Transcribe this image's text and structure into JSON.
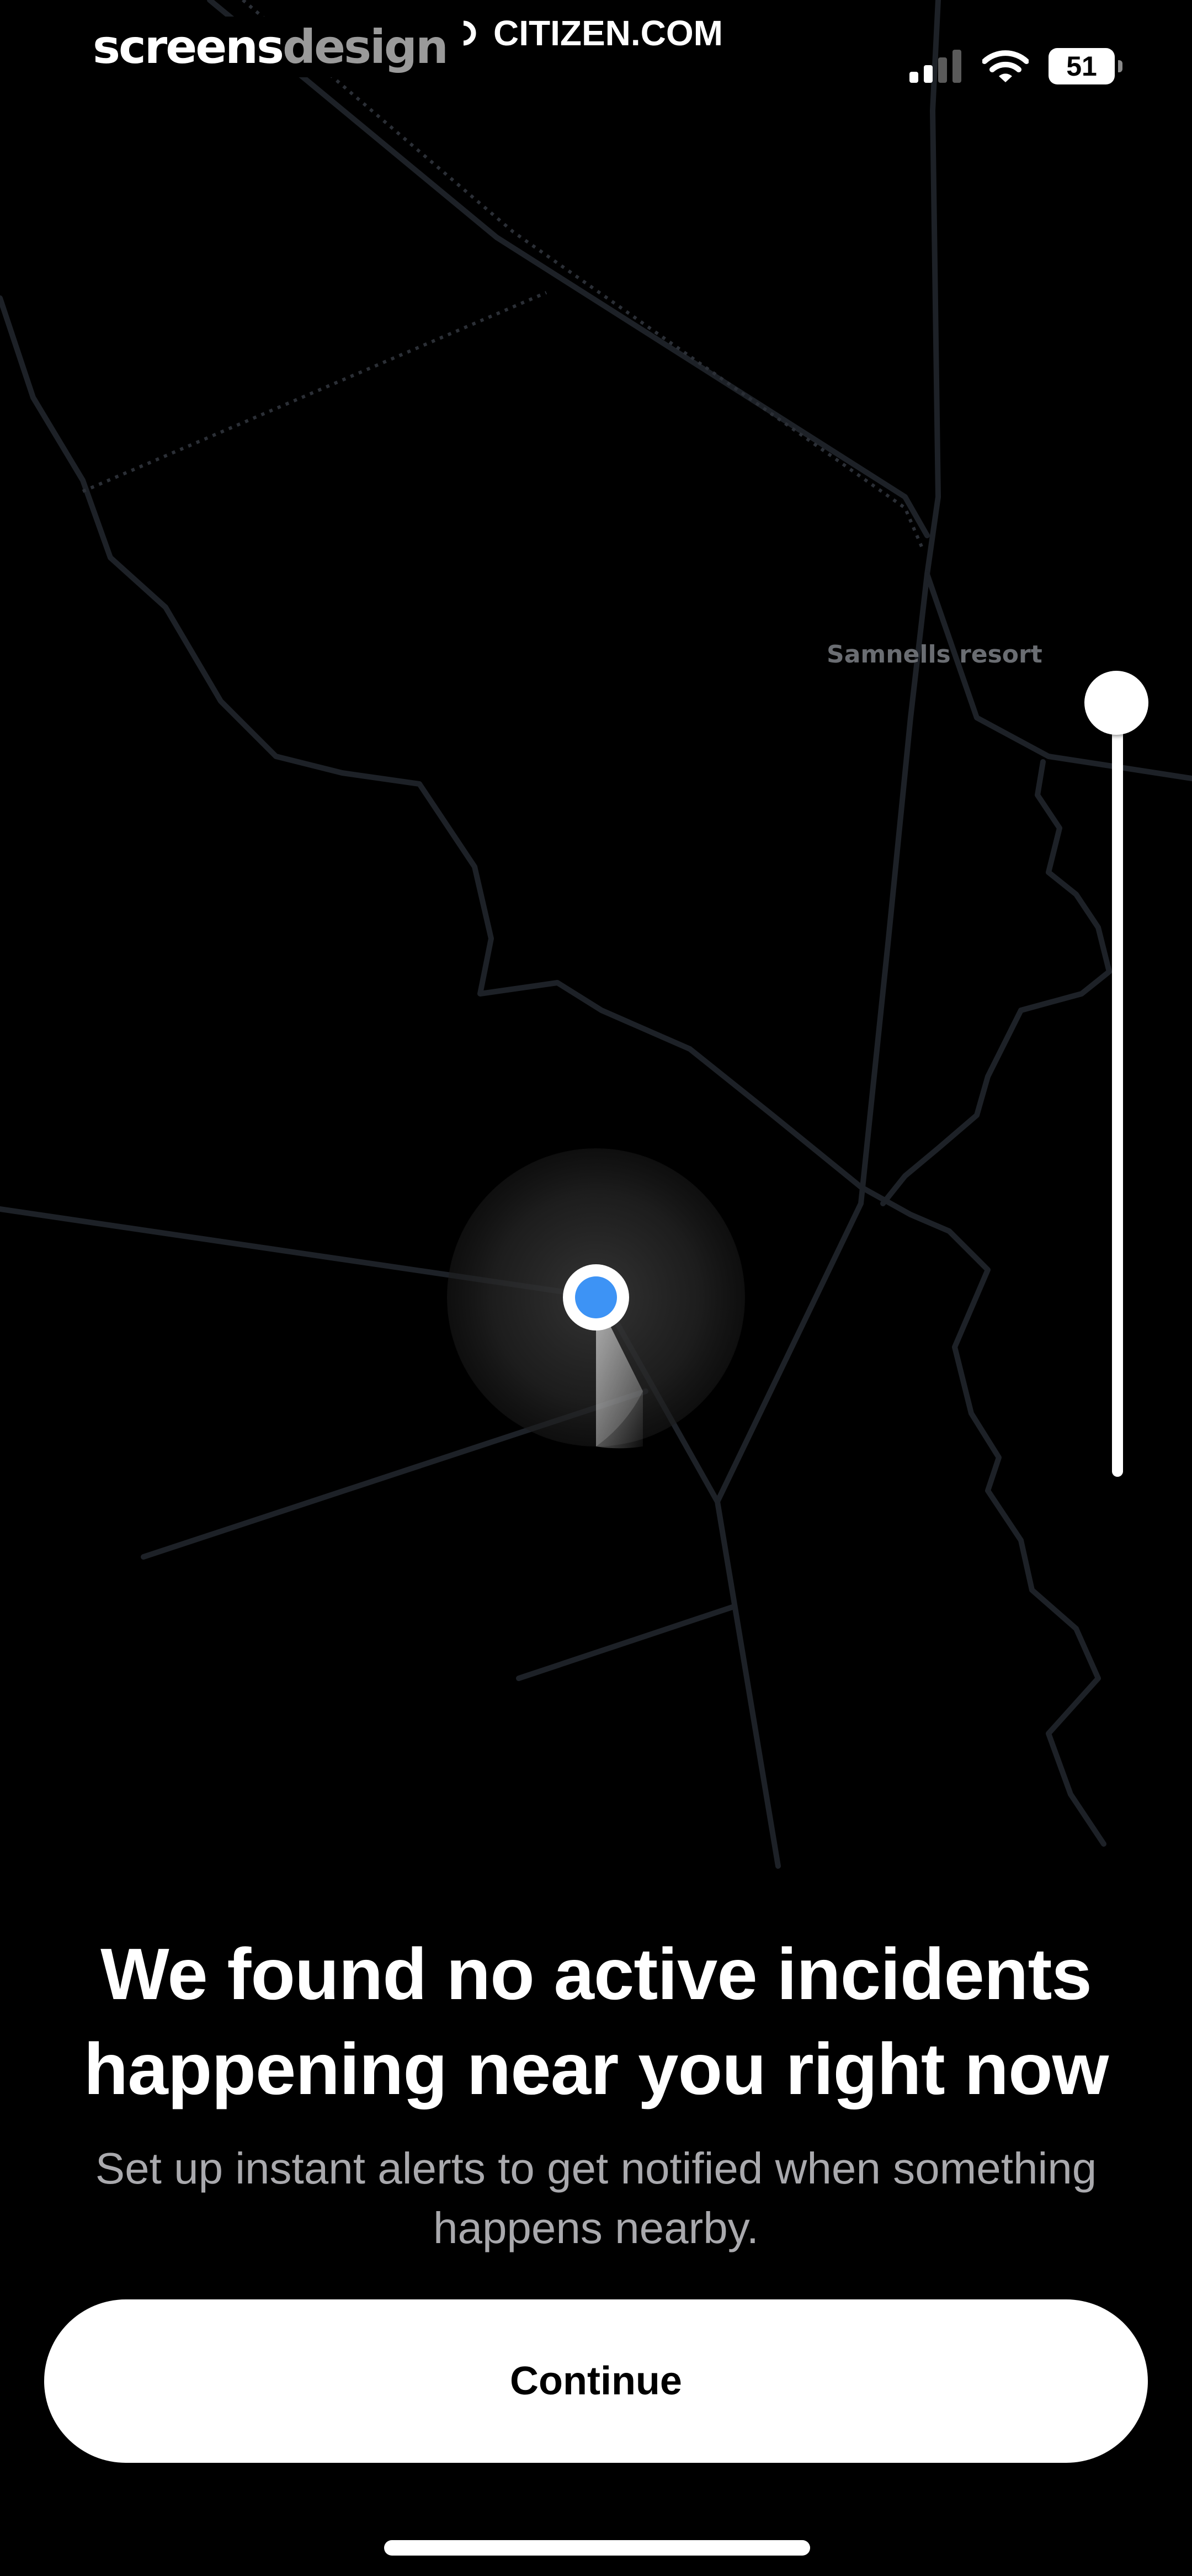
{
  "status_bar": {
    "watermark_part1": "screens",
    "watermark_part2": "design",
    "site_label": "CITIZEN.COM",
    "battery_level": "51",
    "icons": [
      "signal-icon",
      "wifi-icon",
      "battery-icon"
    ]
  },
  "map": {
    "place_label": "Samnells resort",
    "radius_slider_level": 1.0,
    "colors": {
      "background": "#000000",
      "road": "#1d2127",
      "user_dot": "#3d93f5",
      "radius_glow": "#2a2a2a"
    }
  },
  "content": {
    "headline": "We found no active incidents happening near you right now",
    "subtext": "Set up instant alerts to get notified when something happens nearby."
  },
  "actions": {
    "continue_label": "Continue"
  }
}
